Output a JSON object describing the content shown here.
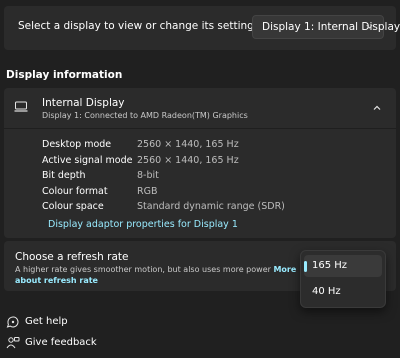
{
  "display_select": {
    "prompt": "Select a display to view or change its settings",
    "selected": "Display 1: Internal Display"
  },
  "display_info": {
    "section_title": "Display information",
    "name": "Internal Display",
    "subtitle": "Display 1: Connected to AMD Radeon(TM) Graphics",
    "properties": [
      {
        "label": "Desktop mode",
        "value": "2560 × 1440, 165 Hz"
      },
      {
        "label": "Active signal mode",
        "value": "2560 × 1440, 165 Hz"
      },
      {
        "label": "Bit depth",
        "value": "8-bit"
      },
      {
        "label": "Colour format",
        "value": "RGB"
      },
      {
        "label": "Colour space",
        "value": "Standard dynamic range (SDR)"
      }
    ],
    "adaptor_link": "Display adaptor properties for Display 1"
  },
  "refresh_rate": {
    "title": "Choose a refresh rate",
    "description": "A higher rate gives smoother motion, but also uses more power",
    "more_link": "More about refresh rate",
    "options": [
      "165 Hz",
      "40 Hz"
    ],
    "selected": "165 Hz"
  },
  "links": {
    "get_help": "Get help",
    "give_feedback": "Give feedback"
  },
  "colors": {
    "background": "#202020",
    "card": "#2b2b2b",
    "accent": "#99ebff"
  },
  "icons": [
    "chevron-down-icon",
    "monitor-icon",
    "chevron-up-icon",
    "help-icon",
    "feedback-icon"
  ]
}
